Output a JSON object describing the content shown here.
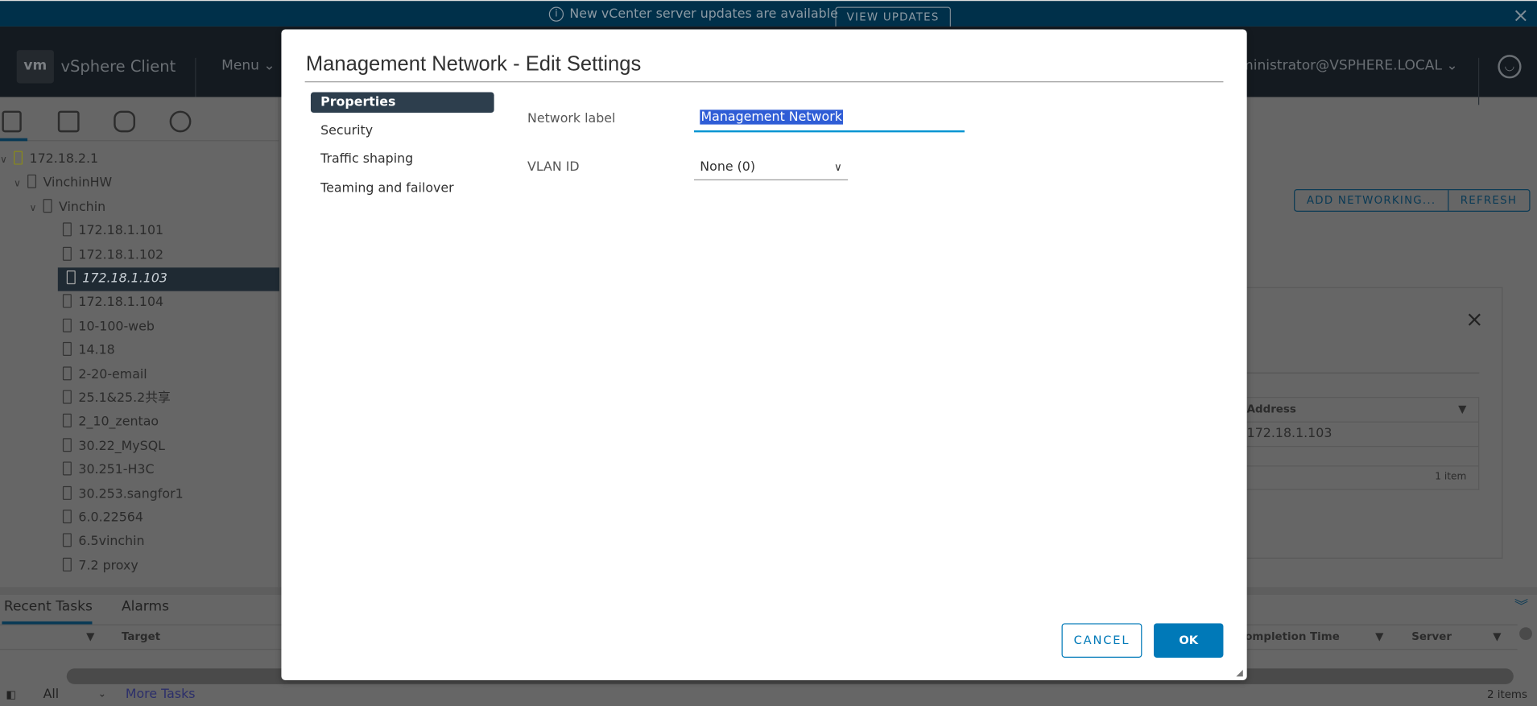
{
  "banner": {
    "message": "New vCenter server updates are available",
    "view_updates": "VIEW UPDATES",
    "close": "×"
  },
  "header": {
    "logo": "vm",
    "app_name": "vSphere Client",
    "menu": "Menu",
    "user": "ministrator@VSPHERE.LOCAL"
  },
  "tree": [
    {
      "label": "172.18.2.1",
      "chevron": "⌄"
    },
    {
      "label": "VinchinHW",
      "chevron": "⌄"
    },
    {
      "label": "Vinchin",
      "chevron": "⌄"
    },
    {
      "label": "172.18.1.101"
    },
    {
      "label": "172.18.1.102"
    },
    {
      "label": "172.18.1.103",
      "selected": true
    },
    {
      "label": "172.18.1.104"
    },
    {
      "label": "10-100-web"
    },
    {
      "label": "14.18"
    },
    {
      "label": "2-20-email"
    },
    {
      "label": "25.1&25.2共享"
    },
    {
      "label": "2_10_zentao"
    },
    {
      "label": "30.22_MySQL"
    },
    {
      "label": "30.251-H3C"
    },
    {
      "label": "30.253.sangfor1"
    },
    {
      "label": "6.0.22564"
    },
    {
      "label": "6.5vinchin"
    },
    {
      "label": "7.2 proxy"
    }
  ],
  "main": {
    "add_networking": "ADD NETWORKING...",
    "refresh": "REFRESH",
    "table": {
      "header": "Address",
      "row": "172.18.1.103",
      "footer": "1 item"
    }
  },
  "bottom": {
    "tabs": [
      "Recent Tasks",
      "Alarms"
    ],
    "columns": [
      "Target",
      "ompletion Time",
      "Server"
    ],
    "filter": "All",
    "more_tasks": "More Tasks",
    "count": "2 items"
  },
  "dialog": {
    "title": "Management Network - Edit Settings",
    "nav": [
      "Properties",
      "Security",
      "Traffic shaping",
      "Teaming and failover"
    ],
    "network_label_label": "Network label",
    "network_label_value": "Management Network",
    "vlan_label": "VLAN ID",
    "vlan_value": "None (0)",
    "cancel": "CANCEL",
    "ok": "OK"
  },
  "colors": {
    "primary": "#0079b8",
    "nav_selected": "#2d3e4d",
    "banner": "#00304a",
    "header": "#141a20"
  }
}
